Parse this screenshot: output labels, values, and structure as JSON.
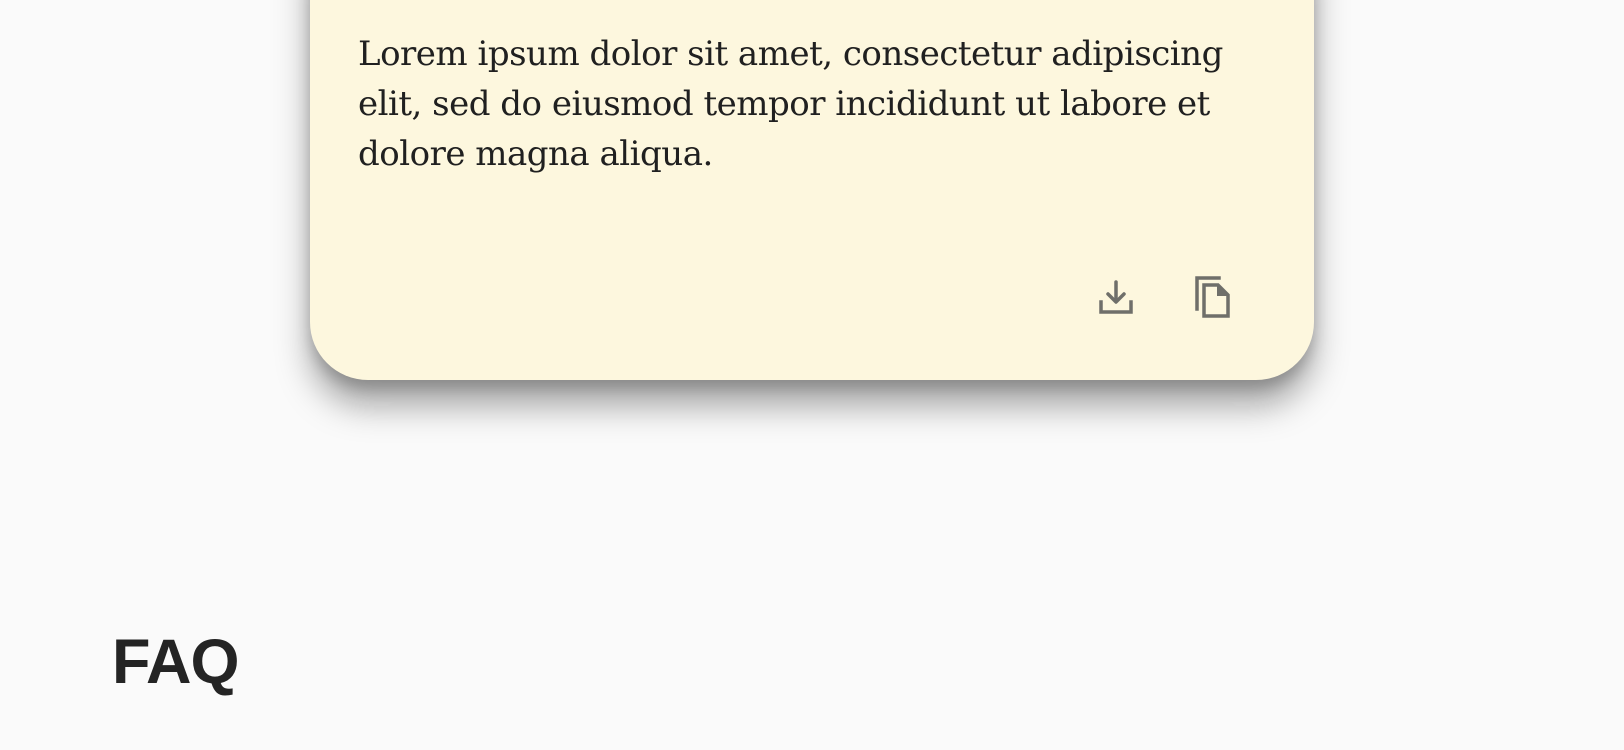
{
  "card": {
    "text": "Lorem ipsum dolor sit amet, consectetur adipiscing elit, sed do eiusmod tempor incididunt ut labore et dolore magna aliqua.",
    "background_color": "#fdf7de",
    "actions": [
      {
        "icon": "download-icon"
      },
      {
        "icon": "copy-icon"
      }
    ]
  },
  "faq": {
    "heading": "FAQ"
  },
  "colors": {
    "page_background": "#fafafa",
    "text": "#202020",
    "icon": "#6f6f6a"
  }
}
